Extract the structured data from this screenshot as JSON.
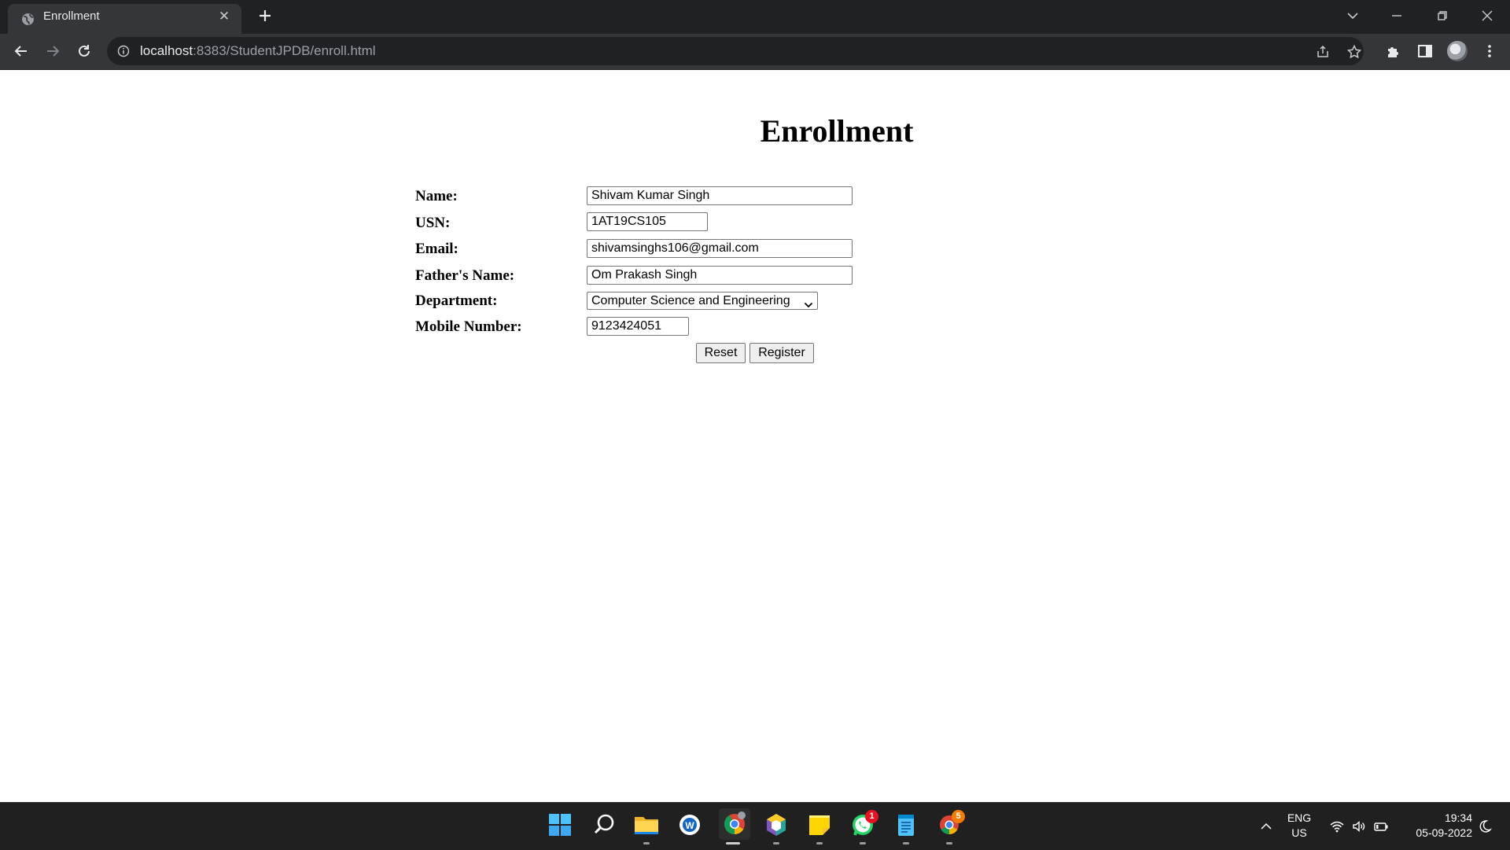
{
  "browser": {
    "tab_title": "Enrollment",
    "url_host": "localhost",
    "url_rest": ":8383/StudentJPDB/enroll.html",
    "colors": {
      "tabbar": "#202124",
      "toolbar": "#35363a",
      "omnibox": "#202124"
    }
  },
  "page": {
    "title": "Enrollment",
    "form": {
      "name_label": "Name:",
      "name_value": "Shivam Kumar Singh",
      "usn_label": "USN:",
      "usn_value": "1AT19CS105",
      "email_label": "Email:",
      "email_value": "shivamsinghs106@gmail.com",
      "father_label": "Father's Name:",
      "father_value": "Om Prakash Singh",
      "department_label": "Department:",
      "department_value": "Computer Science and Engineering",
      "mobile_label": "Mobile Number:",
      "mobile_value": "9123424051",
      "reset_label": "Reset",
      "register_label": "Register"
    }
  },
  "taskbar": {
    "apps": [
      "start-icon",
      "search-icon",
      "file-explorer-icon",
      "word-icon",
      "chrome-icon",
      "app-cube-icon",
      "sticky-notes-icon",
      "whatsapp-icon",
      "notepad-icon",
      "chrome-canary-icon"
    ],
    "whatsapp_badge": "1",
    "chrome2_badge": "5",
    "lang_line1": "ENG",
    "lang_line2": "US",
    "time": "19:34",
    "date": "05-09-2022"
  }
}
